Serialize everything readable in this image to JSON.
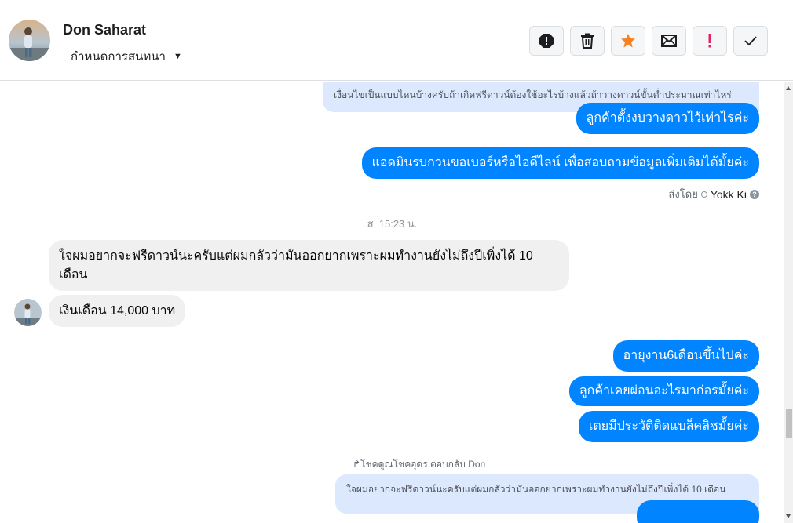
{
  "header": {
    "contact_name": "Don Saharat",
    "assign_label": "กำหนดการสนทนา",
    "toolbar": [
      {
        "name": "spam",
        "icon": "alert-octagon-icon"
      },
      {
        "name": "delete",
        "icon": "trash-icon"
      },
      {
        "name": "star",
        "icon": "star-icon"
      },
      {
        "name": "mark-unread",
        "icon": "envelope-icon"
      },
      {
        "name": "important",
        "icon": "exclamation-icon"
      },
      {
        "name": "done",
        "icon": "check-icon"
      }
    ]
  },
  "messages": {
    "quoted_top": "เงื่อนไขเป็นแบบไหนบ้างครับถ้าเกิดฟรีดาวน์ต้องใช้อะไรบ้างแล้วถ้าวางดาวน์ขั้นต่ำประมาณเท่าไหร่",
    "out_1": "ลูกค้าตั้งงบวางดาวไว้เท่าไรค่ะ",
    "out_2": "แอดมินรบกวนขอเบอร์หรือไอดีไลน์ เพื่อสอบถามข้อมูลเพิ่มเติมได้มั้ยค่ะ",
    "sent_by_label": "ส่งโดย",
    "sent_by_name": "Yokk Ki",
    "timestamp": "ส. 15:23 น.",
    "in_1": "ใจผมอยากจะฟรีดาวน์นะครับแต่ผมกลัวว่ามันออกยากเพราะผมทำงานยังไม่ถึงปีเพิ่งได้ 10 เดือน",
    "in_2": "เงินเดือน 14,000 บาท",
    "out_3": "อายุงาน6เดือนขึ้นไปค่ะ",
    "out_4": "ลูกค้าเคยผ่อนอะไรมาก่อรมั้ยค่ะ",
    "out_5": "เตยมีประวัติติดแบล็คลิชมั้ยค่ะ",
    "reply_note": "โชคดูณโชคอุดร ตอบกลับ Don",
    "quoted_bottom": "ใจผมอยากจะฟรีดาวน์นะครับแต่ผมกลัวว่ามันออกยากเพราะผมทำงานยังไม่ถึงปีเพิ่งได้ 10 เดือน"
  },
  "colors": {
    "outgoing_bubble": "#0084ff",
    "incoming_bubble": "#f0f0f0",
    "quote_bubble": "#dce8fd",
    "star": "#f5821f",
    "important": "#e0245e"
  }
}
